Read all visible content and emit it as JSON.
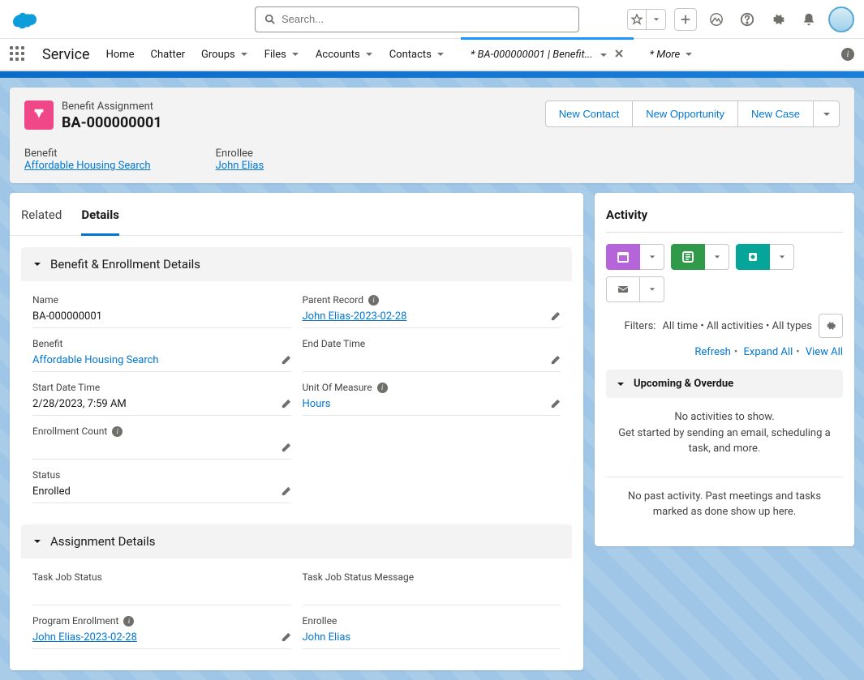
{
  "search": {
    "placeholder": "Search..."
  },
  "app_name": "Service",
  "nav": {
    "home": "Home",
    "chatter": "Chatter",
    "groups": "Groups",
    "files": "Files",
    "accounts": "Accounts",
    "contacts": "Contacts",
    "active_tab": "* BA-000000001 | Benefit...",
    "more": "* More"
  },
  "header": {
    "object": "Benefit Assignment",
    "title": "BA-000000001",
    "actions": {
      "contact": "New Contact",
      "opportunity": "New Opportunity",
      "case": "New Case"
    },
    "benefit_label": "Benefit",
    "benefit_value": "Affordable Housing Search",
    "enrollee_label": "Enrollee",
    "enrollee_value": "John Elias"
  },
  "tabs": {
    "related": "Related",
    "details": "Details"
  },
  "section1": {
    "title": "Benefit & Enrollment Details",
    "name_label": "Name",
    "name_value": "BA-000000001",
    "benefit_label": "Benefit",
    "benefit_value": "Affordable Housing Search",
    "start_label": "Start Date Time",
    "start_value": "2/28/2023, 7:59 AM",
    "count_label": "Enrollment Count",
    "status_label": "Status",
    "status_value": "Enrolled",
    "parent_label": "Parent Record",
    "parent_value": "John Elias-2023-02-28",
    "end_label": "End Date Time",
    "uom_label": "Unit Of Measure",
    "uom_value": "Hours"
  },
  "section2": {
    "title": "Assignment Details",
    "task_status_label": "Task Job Status",
    "task_msg_label": "Task Job Status Message",
    "pe_label": "Program Enrollment",
    "pe_value": "John Elias-2023-02-28",
    "enrollee_label": "Enrollee",
    "enrollee_value": "John Elias"
  },
  "activity": {
    "title": "Activity",
    "filters_prefix": "Filters:",
    "filters_text": "All time  •  All activities  •  All types",
    "refresh": "Refresh",
    "expand": "Expand All",
    "view": "View All",
    "upcoming": "Upcoming & Overdue",
    "empty1": "No activities to show.",
    "empty2": "Get started by sending an email, scheduling a task, and more.",
    "past": "No past activity. Past meetings and tasks marked as done show up here."
  }
}
